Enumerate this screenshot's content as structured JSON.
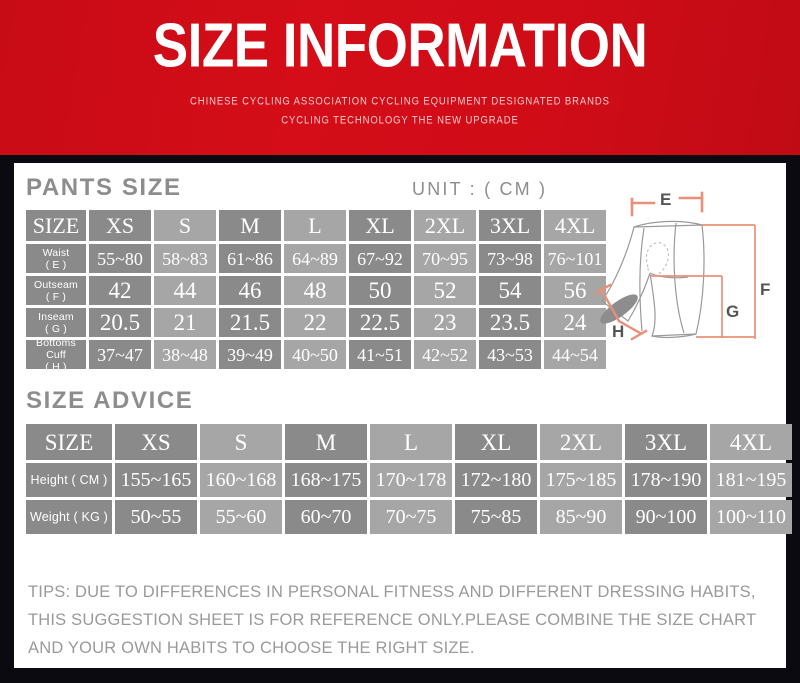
{
  "header": {
    "title": "SIZE INFORMATION",
    "subtitle_line1": "CHINESE CYCLING ASSOCIATION CYCLING EQUIPMENT DESIGNATED BRANDS",
    "subtitle_line2": "CYCLING TECHNOLOGY THE NEW UPGRADE",
    "background_color": "#d40d18",
    "title_color": "#ffffff",
    "subtitle_color": "#f2c9cb"
  },
  "pants_section": {
    "heading": "PANTS SIZE",
    "unit_label": "UNIT :  ( CM )",
    "columns": [
      "SIZE",
      "XS",
      "S",
      "M",
      "L",
      "XL",
      "2XL",
      "3XL",
      "4XL"
    ],
    "rows": [
      {
        "label_line1": "Waist",
        "label_line2": "( E )",
        "values": [
          "55~80",
          "58~83",
          "61~86",
          "64~89",
          "67~92",
          "70~95",
          "73~98",
          "76~101"
        ]
      },
      {
        "label_line1": "Outseam",
        "label_line2": "( F )",
        "values": [
          "42",
          "44",
          "46",
          "48",
          "50",
          "52",
          "54",
          "56"
        ]
      },
      {
        "label_line1": "Inseam",
        "label_line2": "( G )",
        "values": [
          "20.5",
          "21",
          "21.5",
          "22",
          "22.5",
          "23",
          "23.5",
          "24"
        ]
      },
      {
        "label_line1": "Bottoms Cuff",
        "label_line2": "( H )",
        "values": [
          "37~47",
          "38~48",
          "39~49",
          "40~50",
          "41~51",
          "42~52",
          "43~53",
          "44~54"
        ]
      }
    ]
  },
  "advice_section": {
    "heading": "SIZE ADVICE",
    "columns": [
      "SIZE",
      "XS",
      "S",
      "M",
      "L",
      "XL",
      "2XL",
      "3XL",
      "4XL"
    ],
    "rows": [
      {
        "label": "Height ( CM )",
        "values": [
          "155~165",
          "160~168",
          "168~175",
          "170~178",
          "172~180",
          "175~185",
          "178~190",
          "181~195"
        ]
      },
      {
        "label": "Weight ( KG )",
        "values": [
          "50~55",
          "55~60",
          "60~70",
          "70~75",
          "75~85",
          "85~90",
          "90~100",
          "100~110"
        ]
      }
    ]
  },
  "tips": {
    "text": "TIPS: DUE TO DIFFERENCES IN PERSONAL FITNESS AND DIFFERENT DRESSING HABITS, THIS SUGGESTION SHEET IS FOR REFERENCE ONLY.PLEASE COMBINE THE SIZE CHART AND YOUR OWN HABITS TO CHOOSE THE RIGHT SIZE."
  },
  "diagram": {
    "description": "cycling shorts measurement diagram",
    "marker_e": "E",
    "marker_f": "F",
    "marker_g": "G",
    "marker_h": "H",
    "marker_color": "#e8907a",
    "outline_color": "#9a9a9a",
    "label_color": "#555555"
  },
  "palette": {
    "cell_dark": "#8a8a8a",
    "cell_light": "#a6a6a6",
    "heading_gray": "#8d8d8d",
    "tips_gray": "#9a9a9a",
    "panel_white": "#ffffff",
    "frame_black": "#0a0a10"
  }
}
